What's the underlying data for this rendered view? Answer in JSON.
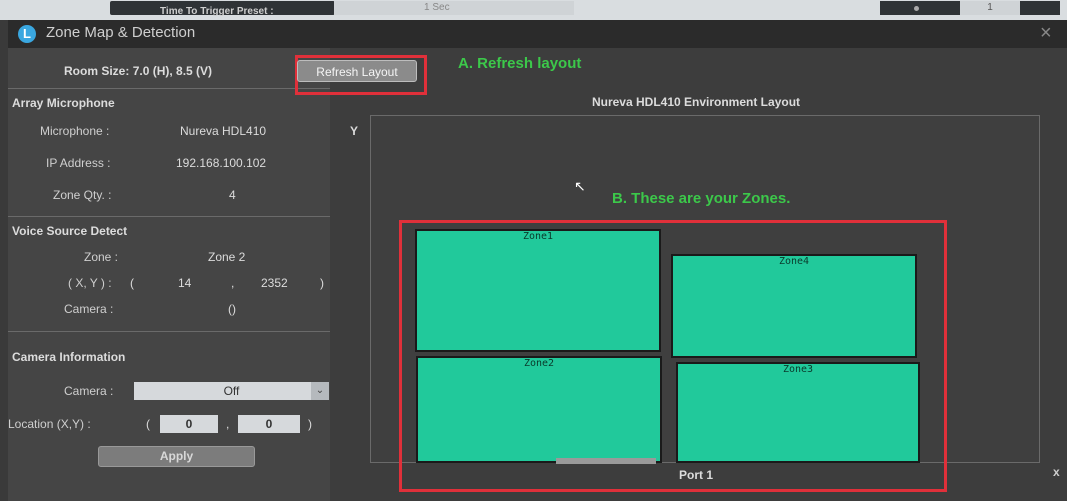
{
  "background": {
    "label": "Time To Trigger Preset :",
    "select_value": "1 Sec",
    "right_value": "1"
  },
  "window": {
    "title": "Zone Map & Detection",
    "close": "×"
  },
  "room": {
    "label": "Room Size:",
    "value": "7.0 (H), 8.5 (V)"
  },
  "refresh_button": "Refresh Layout",
  "annotations": {
    "a": "A. Refresh layout",
    "b": "B. These are your Zones."
  },
  "array_microphone": {
    "heading": "Array Microphone",
    "microphone_label": "Microphone :",
    "microphone_value": "Nureva HDL410",
    "ip_label": "IP Address :",
    "ip_value": "192.168.100.102",
    "zone_qty_label": "Zone Qty. :",
    "zone_qty_value": "4"
  },
  "voice_source": {
    "heading": "Voice Source Detect",
    "zone_label": "Zone :",
    "zone_value": "Zone 2",
    "xy_label": "( X, Y ) :",
    "paren_open": "(",
    "x_value": "14",
    "comma": ",",
    "y_value": "2352",
    "paren_close": ")",
    "camera_label": "Camera :",
    "camera_value": "()"
  },
  "camera_info": {
    "heading": "Camera Information",
    "camera_label": "Camera :",
    "camera_select": "Off",
    "location_label": "Location (X,Y) :",
    "paren_open": "(",
    "loc_x": "0",
    "comma": ",",
    "loc_y": "0",
    "paren_close": ")",
    "apply": "Apply"
  },
  "layout": {
    "title": "Nureva HDL410 Environment Layout",
    "y_axis": "Y",
    "port": "Port 1",
    "x_mark": "x",
    "zones": [
      "Zone1",
      "Zone2",
      "Zone3",
      "Zone4"
    ]
  },
  "colors": {
    "zone_fill": "#21c99b",
    "annotation_box": "#e0303a",
    "annotation_text": "#3cc84a"
  }
}
